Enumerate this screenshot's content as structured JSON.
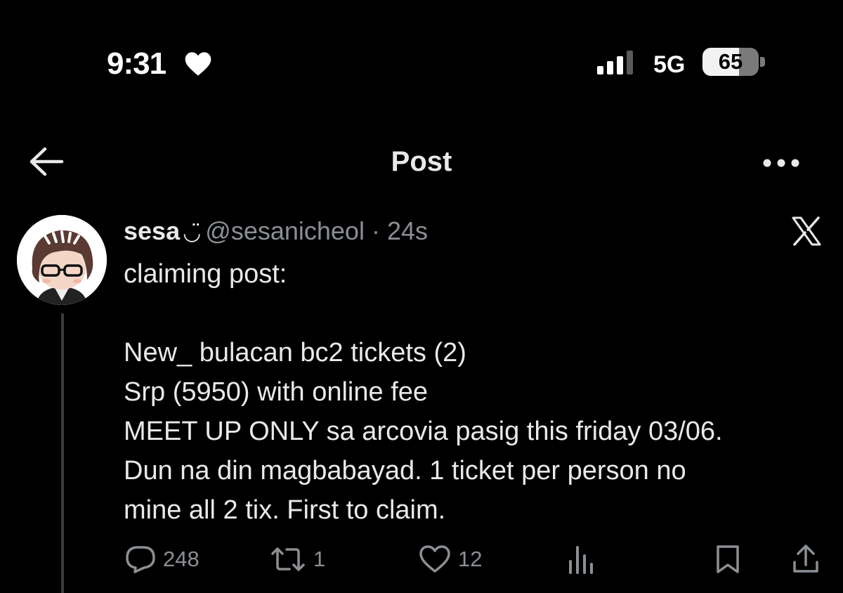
{
  "status_bar": {
    "time": "9:31",
    "network": "5G",
    "battery_level": "65",
    "battery_fraction": 0.65
  },
  "nav": {
    "title": "Post"
  },
  "post": {
    "name": "sesa",
    "name_emoji": "◡̈",
    "handle": "@sesanicheol",
    "separator": "·",
    "time_ago": "24s",
    "lines": [
      "claiming post:",
      "",
      "New_ bulacan bc2 tickets (2)",
      "Srp (5950) with online fee",
      "MEET UP ONLY sa arcovia pasig this friday 03/06.",
      "Dun na din magbabayad. 1 ticket per person no",
      "mine all 2 tix. First to claim."
    ],
    "actions": {
      "replies": "248",
      "reposts": "1",
      "likes": "12"
    }
  },
  "colors": {
    "background": "#000000",
    "text": "#e7e9ea",
    "muted": "#8b8f94",
    "thread_line": "#3b3b3b"
  },
  "icons": [
    "heart-icon",
    "signal-icon",
    "battery-icon",
    "back-arrow-icon",
    "more-icon",
    "x-logo-icon",
    "reply-icon",
    "repost-icon",
    "like-icon",
    "views-icon",
    "bookmark-icon",
    "share-icon"
  ]
}
